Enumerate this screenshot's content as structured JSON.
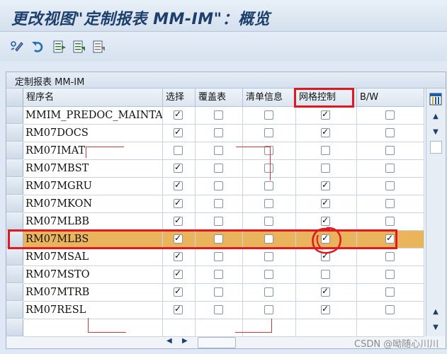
{
  "window": {
    "title": "更改视图\"定制报表 MM-IM\"：概览"
  },
  "toolbar": {
    "icons": [
      "display-change-icon",
      "undo-icon",
      "export-icon",
      "select-all-icon",
      "deselect-icon"
    ]
  },
  "panel": {
    "title": "定制报表 MM-IM"
  },
  "table": {
    "columns": [
      "程序名",
      "选择",
      "覆盖表",
      "清单信息",
      "网格控制",
      "B/W"
    ],
    "rows": [
      {
        "name": "MMIM_PREDOC_MAINTA…",
        "checks": [
          true,
          false,
          false,
          true,
          false
        ]
      },
      {
        "name": "RM07DOCS",
        "checks": [
          true,
          false,
          false,
          true,
          false
        ]
      },
      {
        "name": "RM07IMAT",
        "checks": [
          false,
          false,
          false,
          false,
          false
        ]
      },
      {
        "name": "RM07MBST",
        "checks": [
          true,
          false,
          false,
          false,
          false
        ]
      },
      {
        "name": "RM07MGRU",
        "checks": [
          true,
          false,
          false,
          true,
          false
        ]
      },
      {
        "name": "RM07MKON",
        "checks": [
          true,
          false,
          false,
          true,
          false
        ]
      },
      {
        "name": "RM07MLBB",
        "checks": [
          true,
          false,
          false,
          true,
          false
        ]
      },
      {
        "name": "RM07MLBS",
        "checks": [
          true,
          false,
          false,
          true,
          true
        ],
        "highlighted": true
      },
      {
        "name": "RM07MSAL",
        "checks": [
          true,
          false,
          false,
          true,
          false
        ]
      },
      {
        "name": "RM07MSTO",
        "checks": [
          true,
          false,
          false,
          false,
          false
        ]
      },
      {
        "name": "RM07MTRB",
        "checks": [
          true,
          false,
          false,
          true,
          false
        ]
      },
      {
        "name": "RM07RESL",
        "checks": [
          true,
          false,
          false,
          true,
          false
        ]
      },
      {
        "name": "",
        "checks": [
          false,
          false,
          false,
          false,
          false
        ],
        "empty": true
      }
    ]
  },
  "watermark": "CSDN @呦随心川川",
  "colors": {
    "highlight_row": "#e9b45c",
    "annotation_red": "#e0191f",
    "title_text": "#1d3f6e"
  }
}
